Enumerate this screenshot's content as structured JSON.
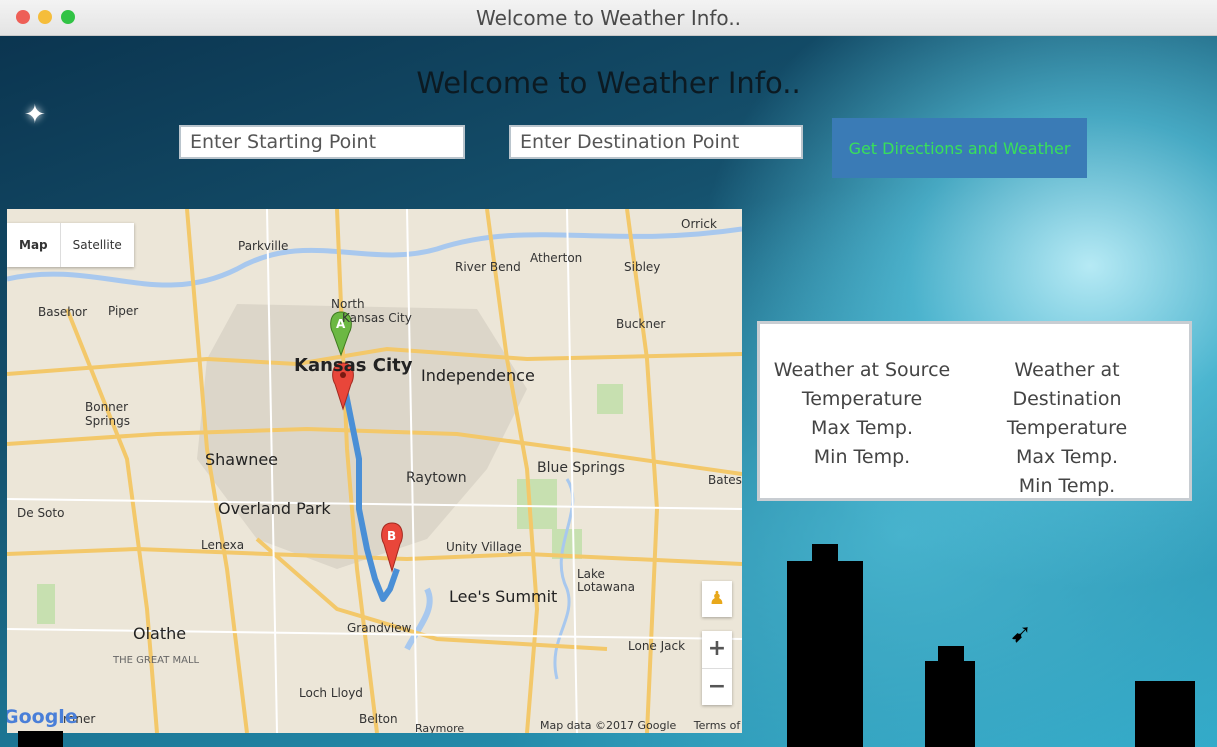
{
  "window": {
    "title": "Welcome to Weather Info.."
  },
  "page": {
    "heading": "Welcome to Weather Info.."
  },
  "search": {
    "start_placeholder": "Enter Starting Point",
    "destination_placeholder": "Enter Destination Point",
    "button_label": "Get Directions and Weather"
  },
  "map": {
    "map_type_active": "Map",
    "map_type_other": "Satellite",
    "logo_text": "Google",
    "attribution": "Map data ©2017 Google",
    "terms": "Terms of Use",
    "marker_a": "A",
    "marker_b": "B",
    "places": {
      "kansas_city": "Kansas City",
      "independence": "Independence",
      "overland_park": "Overland Park",
      "shawnee": "Shawnee",
      "lees_summit": "Lee's Summit",
      "olathe": "Olathe",
      "blue_springs": "Blue Springs",
      "raytown": "Raytown",
      "grandview": "Grandview",
      "parkville": "Parkville",
      "river_bend": "River Bend",
      "atherton": "Atherton",
      "sibley": "Sibley",
      "orrick": "Orrick",
      "basehor": "Basehor",
      "piper": "Piper",
      "north_kc": "North",
      "kansas_city_small": "Kansas City",
      "buckner": "Buckner",
      "bonner_springs": "Bonner Springs",
      "de_soto": "De Soto",
      "lenexa": "Lenexa",
      "unity_village": "Unity Village",
      "lake_lotawana": "Lake Lotawana",
      "lone_jack": "Lone Jack",
      "loch_lloyd": "Loch Lloyd",
      "belton": "Belton",
      "the_great_mall": "THE GREAT MALL",
      "bates": "Bates",
      "raymore": "Raymore",
      "gardner": "rdner"
    }
  },
  "weather": {
    "source": {
      "heading": "Weather at Source",
      "temperature": "Temperature",
      "max_temp": "Max Temp.",
      "min_temp": "Min Temp."
    },
    "destination": {
      "heading": "Weather at Destination",
      "temperature": "Temperature",
      "max_temp": "Max Temp.",
      "min_temp": "Min Temp."
    }
  },
  "colors": {
    "button_bg": "#3a7bb6",
    "button_text": "#38e05a",
    "route": "#4a8fd6",
    "marker_a": "#6cb843",
    "marker_b": "#e9463a"
  }
}
